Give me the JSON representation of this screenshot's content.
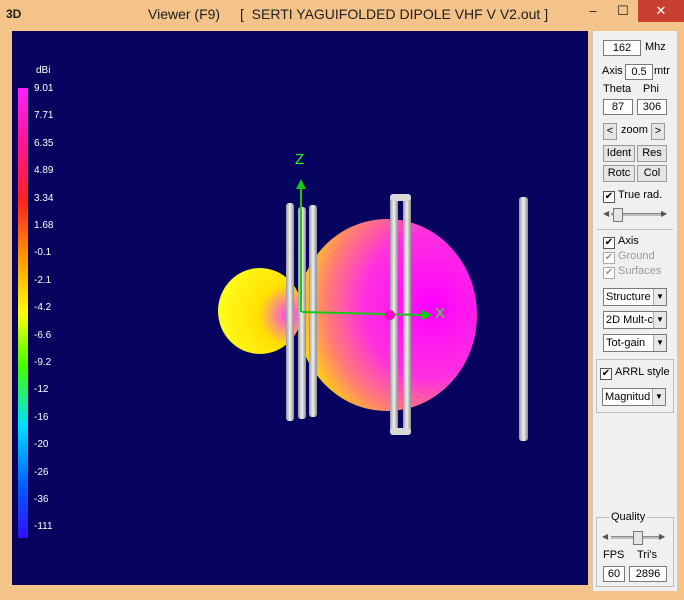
{
  "titlebar": {
    "app_icon_label": "3D",
    "title": "Viewer (F9)",
    "file": "[  SERTI YAGUIFOLDED DIPOLE VHF V V2.out ]",
    "minimize": "–",
    "maximize": "☐",
    "close": "✕"
  },
  "legend": {
    "unit": "dBi",
    "ticks": [
      "9.01",
      "7.71",
      "6.35",
      "4.89",
      "3.34",
      "1.68",
      "-0.1",
      "-2.1",
      "-4.2",
      "-6.6",
      "-9.2",
      "-12",
      "-16",
      "-20",
      "-26",
      "-36",
      "-111"
    ]
  },
  "axes": {
    "z_label": "Z",
    "x_label": "X"
  },
  "panel": {
    "freq_value": "162",
    "freq_unit": "Mhz",
    "axis_label": "Axis",
    "axis_value": "0.5",
    "axis_unit": "mtr",
    "theta_label": "Theta",
    "phi_label": "Phi",
    "theta_value": "87",
    "phi_value": "306",
    "zoom_label": "zoom",
    "zoom_left": "<",
    "zoom_right": ">",
    "ident_label": "Ident",
    "res_label": "Res",
    "rotc_label": "Rotc",
    "col_label": "Col",
    "true_rad_label": "True rad.",
    "axis_check_label": "Axis",
    "ground_label": "Ground",
    "surfaces_label": "Surfaces",
    "structure_select": "Structure",
    "mode_select": "2D Mult-c",
    "gain_select": "Tot-gain",
    "arrl_label": "ARRL style",
    "magnitude_select": "Magnitud",
    "quality_label": "Quality",
    "fps_label": "FPS",
    "tris_label": "Tri's",
    "fps_value": "60",
    "tris_value": "2896",
    "check_mark": "✔"
  },
  "colors": {
    "viewport_bg": "#06045e",
    "window_frame": "#f3c38a",
    "close_button": "#c7402f"
  }
}
